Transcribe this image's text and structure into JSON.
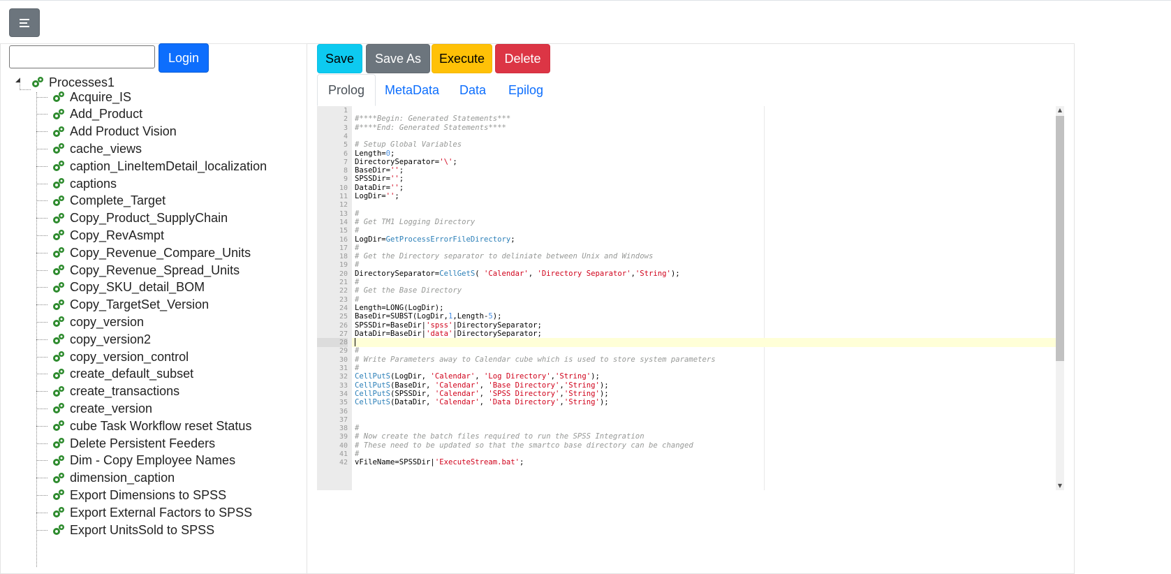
{
  "colors": {
    "menu": "#6c757d",
    "login": "#0d6efd",
    "save": "#0dcaf0",
    "save_as": "#6c757d",
    "execute": "#ffc107",
    "delete": "#dc3545",
    "gear": "#2e8b2e"
  },
  "header": {
    "menu_icon": "hamburger-icon"
  },
  "login": {
    "input_value": "",
    "button_label": "Login"
  },
  "toolbar": {
    "save_label": "Save",
    "save_as_label": "Save As",
    "execute_label": "Execute",
    "delete_label": "Delete"
  },
  "tabs": [
    {
      "label": "Prolog",
      "active": true
    },
    {
      "label": "MetaData",
      "active": false
    },
    {
      "label": "Data",
      "active": false
    },
    {
      "label": "Epilog",
      "active": false
    }
  ],
  "tree": {
    "root": {
      "label": "Processes1",
      "icon": "gears-icon"
    },
    "items": [
      "Acquire_IS",
      "Add_Product",
      "Add Product Vision",
      "cache_views",
      "caption_LineItemDetail_localization",
      "captions",
      "Complete_Target",
      "Copy_Product_SupplyChain",
      "Copy_RevAsmpt",
      "Copy_Revenue_Compare_Units",
      "Copy_Revenue_Spread_Units",
      "Copy_SKU_detail_BOM",
      "Copy_TargetSet_Version",
      "copy_version",
      "copy_version2",
      "copy_version_control",
      "create_default_subset",
      "create_transactions",
      "create_version",
      "cube Task Workflow reset Status",
      "Delete Persistent Feeders",
      "Dim - Copy Employee Names",
      "dimension_caption",
      "Export Dimensions to SPSS",
      "Export External Factors to SPSS",
      "Export UnitsSold to SPSS"
    ]
  },
  "editor": {
    "current_line": 28,
    "lines": [
      "",
      "#****Begin: Generated Statements***",
      "#****End: Generated Statements****",
      "",
      "# Setup Global Variables",
      "Length=0;",
      "DirectorySeparator='\\';",
      "BaseDir='';",
      "SPSSDir='';",
      "DataDir='';",
      "LogDir='';",
      "",
      "#",
      "# Get TM1 Logging Directory",
      "#",
      "LogDir=GetProcessErrorFileDirectory;",
      "#",
      "# Get the Directory separator to deliniate between Unix and Windows",
      "#",
      "DirectorySeparator=CellGetS( 'Calendar', 'Directory Separator','String');",
      "#",
      "# Get the Base Directory",
      "#",
      "Length=LONG(LogDir);",
      "BaseDir=SUBST(LogDir,1,Length-5);",
      "SPSSDir=BaseDir|'spss'|DirectorySeparator;",
      "DataDir=BaseDir|'data'|DirectorySeparator;",
      "",
      "#",
      "# Write Parameters away to Calendar cube which is used to store system parameters",
      "#",
      "CellPutS(LogDir, 'Calendar', 'Log Directory','String');",
      "CellPutS(BaseDir, 'Calendar', 'Base Directory','String');",
      "CellPutS(SPSSDir, 'Calendar', 'SPSS Directory','String');",
      "CellPutS(DataDir, 'Calendar', 'Data Directory','String');",
      "",
      "",
      "#",
      "# Now create the batch files required to run the SPSS Integration",
      "# These need to be updated so that the smartco base directory can be changed",
      "#",
      "vFileName=SPSSDir|'ExecuteStream.bat';"
    ]
  }
}
